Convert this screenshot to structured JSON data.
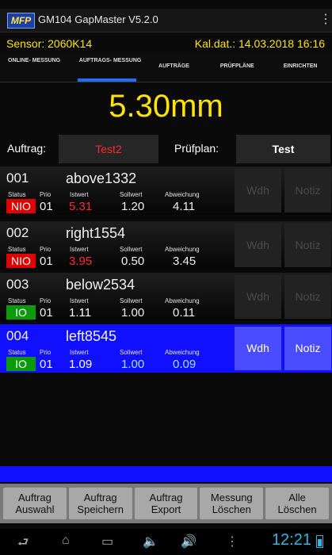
{
  "app": {
    "logo": "MFP",
    "title": "GM104 GapMaster V5.2.0"
  },
  "status": {
    "sensor": "Sensor: 2060K14",
    "kal_dat": "Kal.dat.: 14.03.2018 16:16"
  },
  "tabs": [
    {
      "label": "ONLINE- MESSUNG",
      "active": false
    },
    {
      "label": "AUFTRAGS- MESSUNG",
      "active": true
    },
    {
      "label": "AUFTRÄGE",
      "active": false
    },
    {
      "label": "PRÜFPLÄNE",
      "active": false
    },
    {
      "label": "EINRICHTEN",
      "active": false
    }
  ],
  "measurement": "5.30mm",
  "auftrag": {
    "label": "Auftrag:",
    "value": "Test2"
  },
  "pruefplan": {
    "label": "Prüfplan:",
    "value": "Test"
  },
  "column_labels": {
    "status": "Status",
    "prio": "Prio",
    "istwert": "Istwert",
    "sollwert": "Sollwert",
    "abweichung": "Abweichung"
  },
  "rows": [
    {
      "num": "001",
      "name": "above1332",
      "status": "NIO",
      "prio": "01",
      "istwert": "5.31",
      "sollwert": "1.20",
      "abweichung": "4.11",
      "wdh": "Wdh",
      "notiz": "Notiz"
    },
    {
      "num": "002",
      "name": "right1554",
      "status": "NIO",
      "prio": "01",
      "istwert": "3.95",
      "sollwert": "0.50",
      "abweichung": "3.45",
      "wdh": "Wdh",
      "notiz": "Notiz"
    },
    {
      "num": "003",
      "name": "below2534",
      "status": "IO",
      "prio": "01",
      "istwert": "1.11",
      "sollwert": "1.00",
      "abweichung": "0.11",
      "wdh": "Wdh",
      "notiz": "Notiz"
    },
    {
      "num": "004",
      "name": "left8545",
      "status": "IO",
      "prio": "01",
      "istwert": "1.09",
      "sollwert": "1.00",
      "abweichung": "0.09",
      "wdh": "Wdh",
      "notiz": "Notiz"
    }
  ],
  "actions": [
    {
      "line1": "Auftrag",
      "line2": "Auswahl"
    },
    {
      "line1": "Auftrag",
      "line2": "Speichern"
    },
    {
      "line1": "Auftrag",
      "line2": "Export"
    },
    {
      "line1": "Messung",
      "line2": "Löschen"
    },
    {
      "line1": "Alle",
      "line2": "Löschen"
    }
  ],
  "system": {
    "clock": "12:21"
  },
  "colors": {
    "accent_yellow": "#ffe400",
    "selected_blue": "#1010ff",
    "nio_red": "#e00000",
    "io_green": "#0b9a0b",
    "istwert_red": "#ff2a2a"
  },
  "icons": [
    "menu-dots-icon",
    "back-icon",
    "home-icon",
    "recents-icon",
    "volume-down-icon",
    "volume-up-icon",
    "overflow-icon",
    "battery-icon"
  ]
}
